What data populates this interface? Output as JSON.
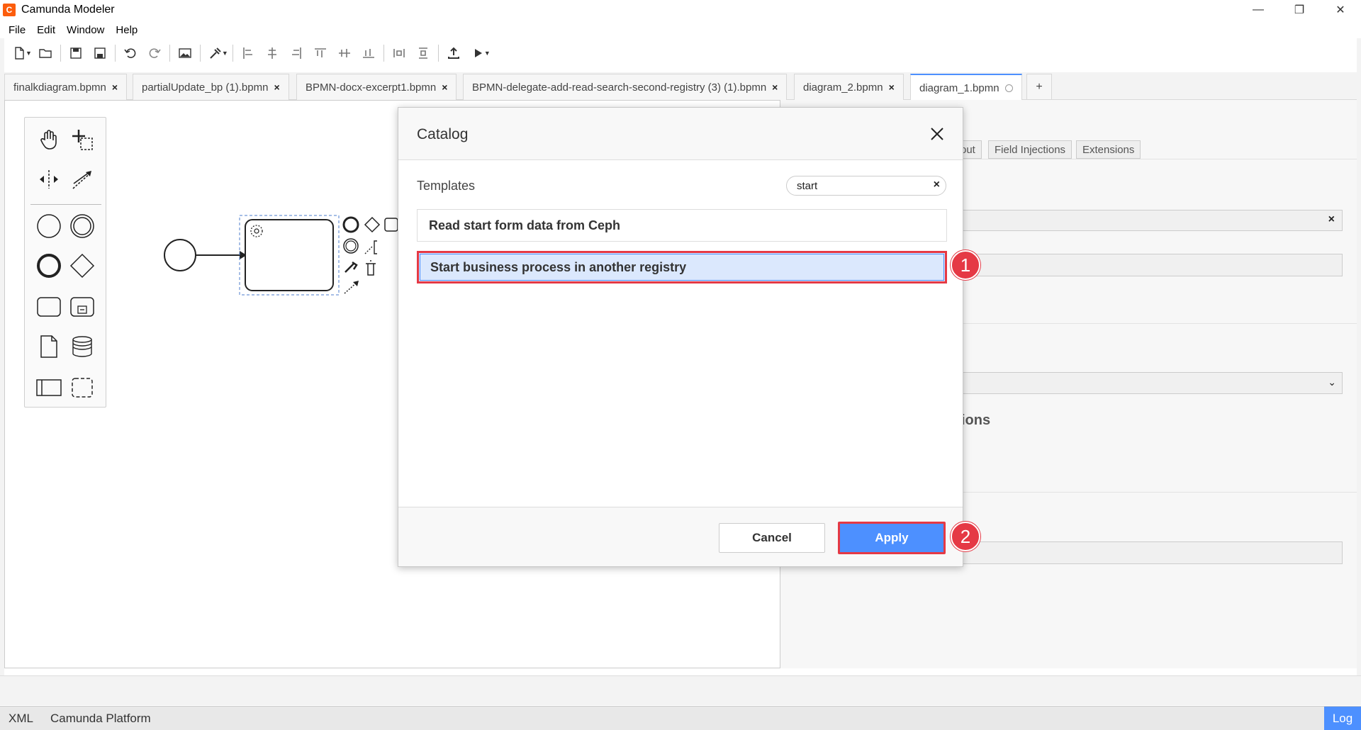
{
  "app": {
    "title": "Camunda Modeler"
  },
  "window_controls": {
    "minimize": "—",
    "restore": "❐",
    "close": "✕"
  },
  "menu": [
    "File",
    "Edit",
    "Window",
    "Help"
  ],
  "tabs": [
    {
      "label": "finalkdiagram.bpmn",
      "close": "×"
    },
    {
      "label": "partialUpdate_bp (1).bpmn",
      "close": "×"
    },
    {
      "label": "BPMN-docx-excerpt1.bpmn",
      "close": "×"
    },
    {
      "label": "BPMN-delegate-add-read-search-second-registry (3) (1).bpmn",
      "close": "×"
    },
    {
      "label": "diagram_2.bpmn",
      "close": "×"
    },
    {
      "label": "diagram_1.bpmn",
      "active": true
    }
  ],
  "tab_add": "+",
  "properties": {
    "tabs": [
      "out",
      "Field Injections",
      "Extensions"
    ],
    "section_heading_fragment": "ions",
    "clear_glyph": "×"
  },
  "modal": {
    "title": "Catalog",
    "templates_label": "Templates",
    "search": {
      "value": "start",
      "clear": "×"
    },
    "templates": [
      {
        "label": "Read start form data from Ceph",
        "selected": false
      },
      {
        "label": "Start business process in another registry",
        "selected": true
      }
    ],
    "cancel_label": "Cancel",
    "apply_label": "Apply"
  },
  "callouts": [
    "1",
    "2"
  ],
  "status": {
    "xml": "XML",
    "platform": "Camunda Platform",
    "log": "Log"
  },
  "colors": {
    "accent": "#4d90ff",
    "highlight": "#e53945",
    "brand": "#fc5d0d"
  }
}
